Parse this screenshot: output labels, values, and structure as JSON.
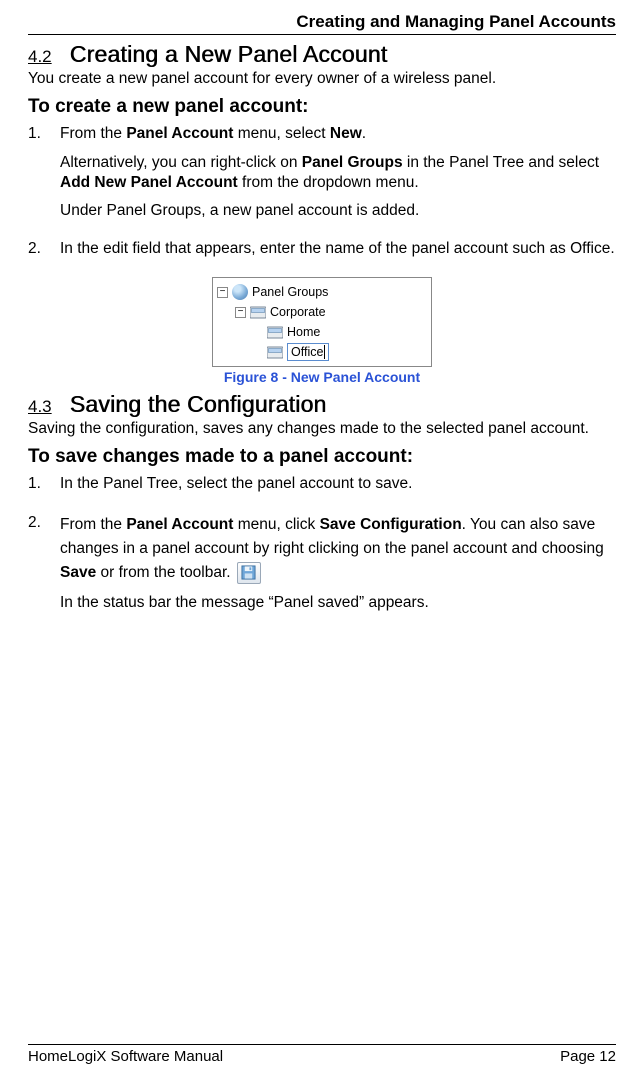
{
  "header": {
    "chapter_title": "Creating and Managing Panel Accounts"
  },
  "section42": {
    "number": "4.2",
    "title": "Creating a New Panel Account",
    "intro": "You create a new panel account for every owner of a wireless panel.",
    "task_heading": "To create a new panel account:",
    "step1_num": "1.",
    "step1_text_pre": "From the ",
    "step1_bold1": "Panel Account",
    "step1_text_mid": " menu, select ",
    "step1_bold2": "New",
    "step1_text_post": ".",
    "step1_alt_pre": "Alternatively, you can right-click on ",
    "step1_alt_bold1": "Panel Groups",
    "step1_alt_mid": " in the Panel Tree and select ",
    "step1_alt_bold2": "Add New Panel Account",
    "step1_alt_post": " from the dropdown menu.",
    "step1_result": "Under Panel Groups, a new panel account is added.",
    "step2_num": "2.",
    "step2_text": "In the edit field that appears, enter the name of the panel account such as Office."
  },
  "figure8": {
    "caption": "Figure 8 - New Panel Account",
    "tree_root": "Panel Groups",
    "tree_item1": "Corporate",
    "tree_item2": "Home",
    "tree_edit": "Office"
  },
  "section43": {
    "number": "4.3",
    "title": "Saving the Configuration",
    "intro": "Saving the configuration, saves any changes made to the selected panel account.",
    "task_heading": "To save changes made to a panel account:",
    "step1_num": "1.",
    "step1_text": "In the Panel Tree, select the panel account to save.",
    "step2_num": "2.",
    "step2_pre": "From the ",
    "step2_bold1": "Panel Account",
    "step2_mid1": " menu, click ",
    "step2_bold2": "Save Configuration",
    "step2_mid2": ". You can also save changes in a panel account by right clicking on the panel account and choosing ",
    "step2_bold3": "Save",
    "step2_mid3": " or from the toolbar. ",
    "step2_result": "In the status bar the message “Panel saved” appears."
  },
  "footer": {
    "manual": "HomeLogiX Software Manual",
    "page": "Page 12"
  }
}
